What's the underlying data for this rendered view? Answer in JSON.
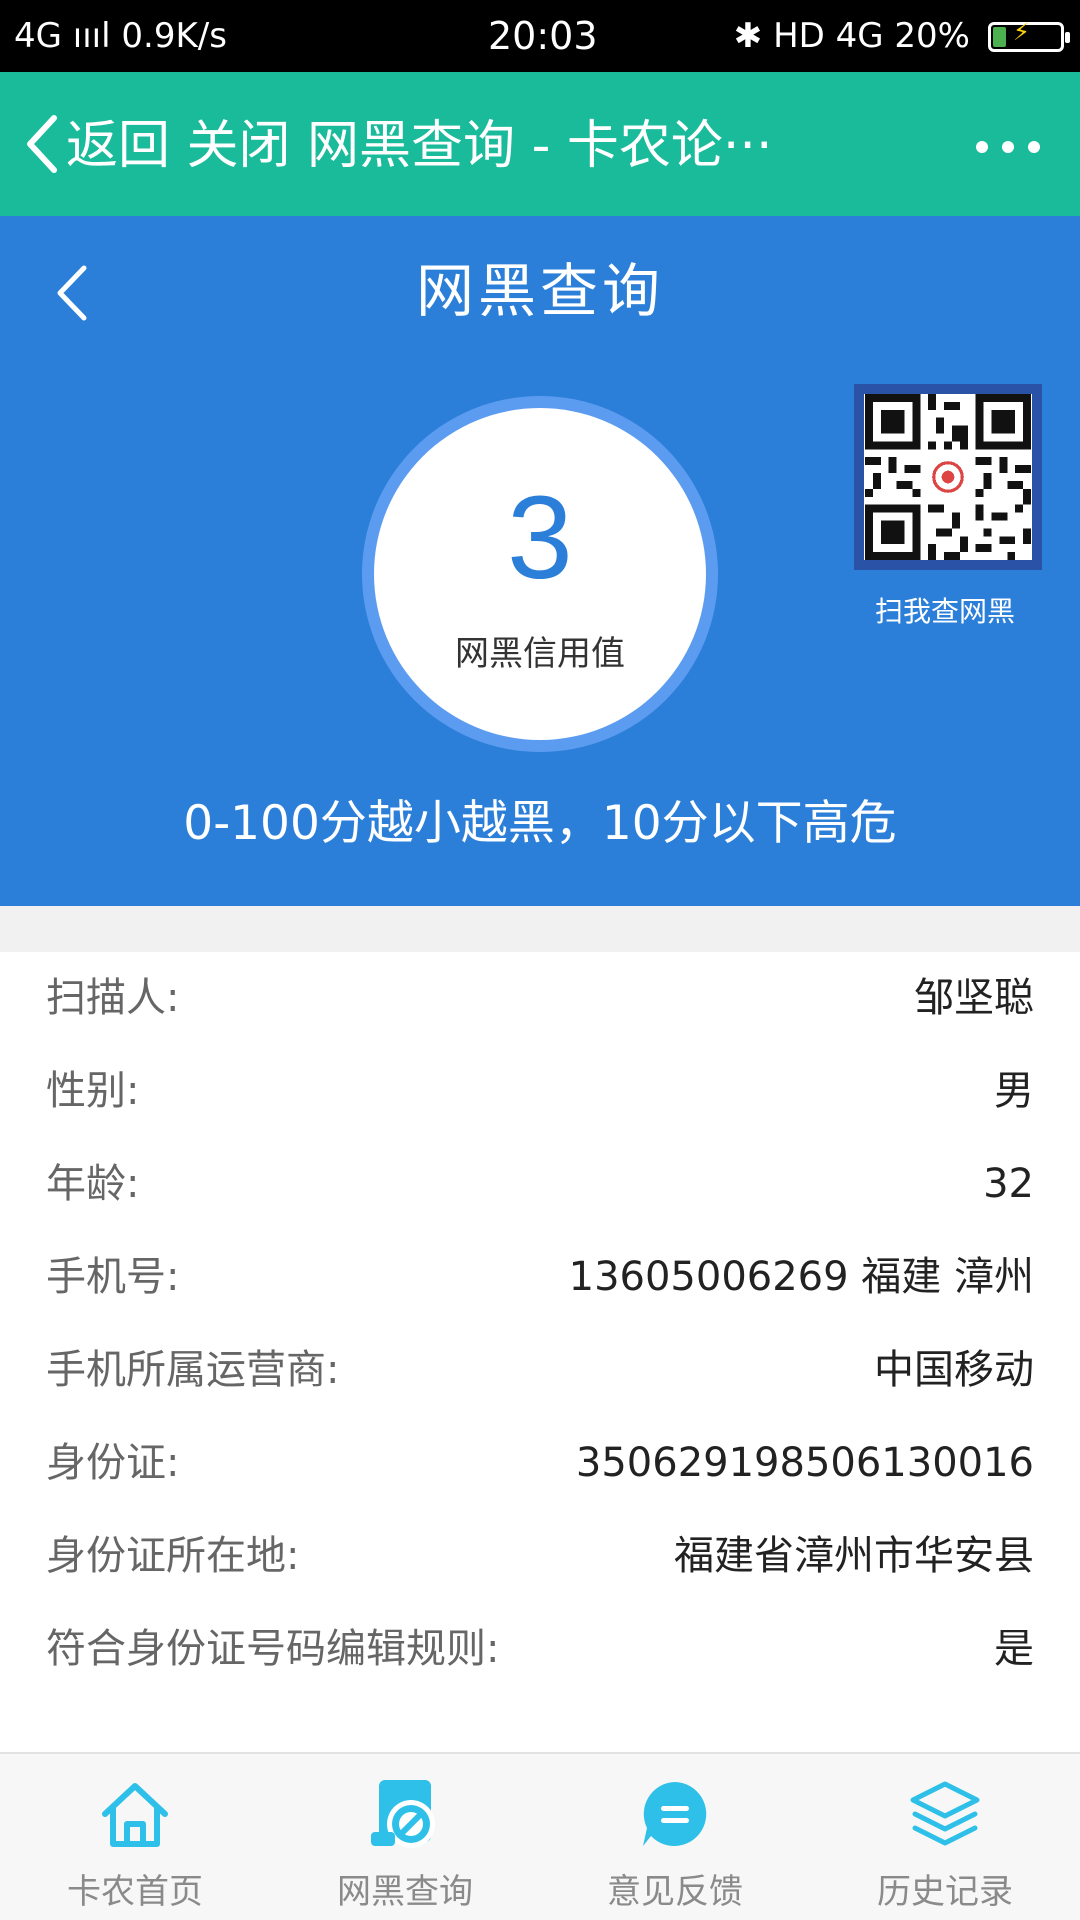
{
  "status_bar": {
    "left": "4G ıııl 0.9K/s",
    "time": "20:03",
    "right": "✱ HD 4G 20%",
    "battery_level": 0.2,
    "battery_color": "#4caf50"
  },
  "nav": {
    "title": "返回 关闭 网黑查询 - 卡农论···",
    "bg_color": "#19bb9b"
  },
  "header": {
    "title": "网黑查询",
    "score": "3",
    "score_label": "网黑信用值",
    "qr_label": "扫我查网黑",
    "hint": "0-100分越小越黑，10分以下高危",
    "bg_color": "#2b7fd9"
  },
  "info": {
    "rows": [
      {
        "label": "扫描人:",
        "value": "邹坚聪"
      },
      {
        "label": "性别:",
        "value": "男"
      },
      {
        "label": "年龄:",
        "value": "32"
      },
      {
        "label": "手机号:",
        "value": "13605006269 福建 漳州"
      },
      {
        "label": "手机所属运营商:",
        "value": "中国移动"
      },
      {
        "label": "身份证:",
        "value": "350629198506130016"
      },
      {
        "label": "身份证所在地:",
        "value": "福建省漳州市华安县"
      },
      {
        "label": "符合身份证号码编辑规则:",
        "value": "是"
      }
    ]
  },
  "tabs": [
    {
      "label": "卡农首页",
      "icon": "home-icon"
    },
    {
      "label": "网黑查询",
      "icon": "search-doc-icon"
    },
    {
      "label": "意见反馈",
      "icon": "feedback-icon"
    },
    {
      "label": "历史记录",
      "icon": "layers-icon"
    }
  ],
  "tab_icon_color": "#2ec0e8"
}
